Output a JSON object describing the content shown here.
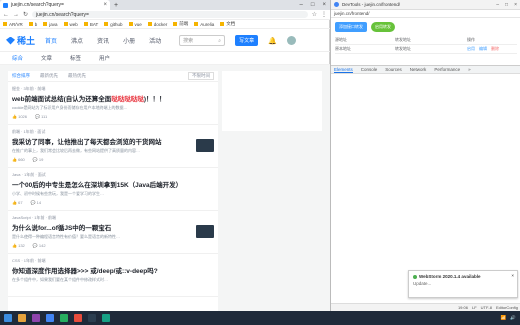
{
  "browser": {
    "tab_title": "juejin.cn/search?query=",
    "address": "juejin.cn/search?query=",
    "bookmarks": [
      "AR/VR",
      "b",
      "java",
      "web",
      "BAT",
      "github",
      "vue",
      "docker",
      "前端",
      "Aurelia",
      "文档"
    ]
  },
  "site": {
    "logo_text": "稀土",
    "nav": [
      "首页",
      "沸点",
      "资讯",
      "小册",
      "活动"
    ],
    "search_placeholder": "搜索",
    "creator_label": "写文章",
    "subnav": [
      "综合",
      "文章",
      "标签",
      "用户"
    ],
    "filters": [
      "综合排序",
      "最新优先",
      "最热优先"
    ],
    "filter_select": "不限时间"
  },
  "entries": [
    {
      "meta": "掘金 · 3年前 · 前端",
      "title_prefix": "web前端面试总结(自认为还算全面",
      "title_highlight": "哒哒哒哒哒",
      "title_suffix": ")！！！",
      "abstract": "cookie是网站为了标识用户身份而储存在用户本地终端上的数据…",
      "likes": "1026",
      "comments": "111"
    },
    {
      "meta": "前端 · 1年前 · 面试",
      "title_prefix": "我采访了同事，让他推出了每天都会浏览的干货网站",
      "title_highlight": "",
      "title_suffix": "",
      "abstract": "在推广的事上，我们常会比较后再去做，有些网站提供了高质量的内容…",
      "likes": "660",
      "comments": "19"
    },
    {
      "meta": "Java · 1年前 · 面试",
      "title_prefix": "一个00后的中专生是怎么在深圳拿到15K（Java后端开发）",
      "title_highlight": "",
      "title_suffix": "",
      "abstract": "小学、初中时候有些贪玩，我是一个爱学习的学生…",
      "likes": "67",
      "comments": "14"
    },
    {
      "meta": "JavaScript · 1年前 · 前端",
      "title_prefix": "为什么说for...of循JS中的一颗宝石",
      "title_highlight": "",
      "title_suffix": "",
      "abstract": "是什么使得一种编程语言特性有价值？要么是语言的新特性…",
      "likes": "132",
      "comments": "142"
    },
    {
      "meta": "CSS · 1年前 · 前端",
      "title_prefix": "你知道深度作用选择器>>> 或/deep/或::v-deep吗?",
      "title_highlight": "",
      "title_suffix": "",
      "abstract": "在多个组件中，如果我们要在某个组件中修改样式时…",
      "likes": "",
      "comments": ""
    }
  ],
  "devtools": {
    "title": "DevTools - juejin.cn/frontend/",
    "url": "juejin.cn/frontend/",
    "btn_primary": "添加接口转发",
    "btn_success": "启用转发",
    "table_headers": [
      "源地址",
      "转发地址",
      "操作"
    ],
    "table_row": [
      "原本地址",
      "转发地址",
      "启用",
      "编辑",
      "删除"
    ],
    "tabs": [
      "Elements",
      "Console",
      "Sources",
      "Network",
      "Performance",
      "»"
    ],
    "toast_title": "WebStorm 2020.1.4 available",
    "toast_sub": "Update...",
    "status": [
      "19:06",
      "LF",
      "UTF-8",
      "EditorConfig"
    ]
  },
  "colors": {
    "brand": "#1e80ff",
    "highlight": "#e8323c",
    "taskbar": "#1f2a3a"
  }
}
